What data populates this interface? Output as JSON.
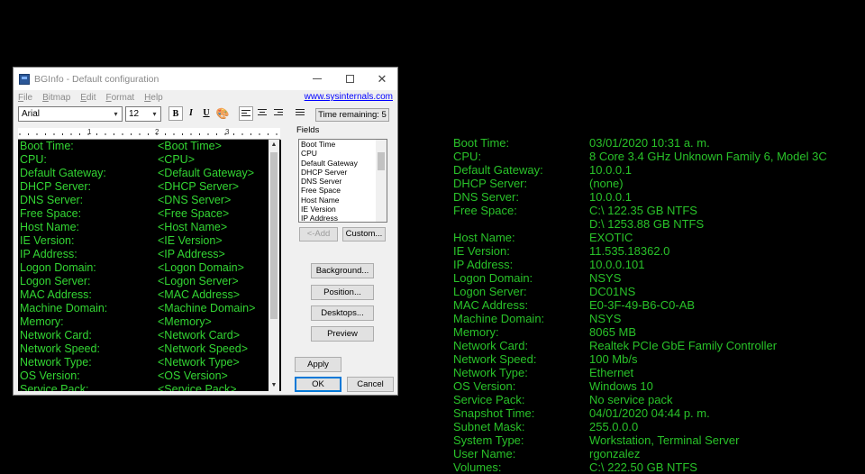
{
  "window": {
    "title": "BGInfo - Default configuration",
    "menu": [
      "File",
      "Bitmap",
      "Edit",
      "Format",
      "Help"
    ],
    "link": "www.sysinternals.com",
    "font_name": "Arial",
    "font_size": "12",
    "bold": "B",
    "italic": "I",
    "underline": "U",
    "time_remaining": "Time remaining: 5",
    "ruler_labels": [
      "1",
      "2",
      "3"
    ],
    "editor_rows": [
      {
        "label": "Boot Time:",
        "value": "<Boot Time>"
      },
      {
        "label": "CPU:",
        "value": "<CPU>"
      },
      {
        "label": "Default Gateway:",
        "value": "<Default Gateway>"
      },
      {
        "label": "DHCP Server:",
        "value": "<DHCP Server>"
      },
      {
        "label": "DNS Server:",
        "value": "<DNS Server>"
      },
      {
        "label": "Free Space:",
        "value": "<Free Space>"
      },
      {
        "label": "Host Name:",
        "value": "<Host Name>"
      },
      {
        "label": "IE Version:",
        "value": "<IE Version>"
      },
      {
        "label": "IP Address:",
        "value": "<IP Address>"
      },
      {
        "label": "Logon Domain:",
        "value": "<Logon Domain>"
      },
      {
        "label": "Logon Server:",
        "value": "<Logon Server>"
      },
      {
        "label": "MAC Address:",
        "value": "<MAC Address>"
      },
      {
        "label": "Machine Domain:",
        "value": "<Machine Domain>"
      },
      {
        "label": "Memory:",
        "value": "<Memory>"
      },
      {
        "label": "Network Card:",
        "value": "<Network Card>"
      },
      {
        "label": "Network Speed:",
        "value": "<Network Speed>"
      },
      {
        "label": "Network Type:",
        "value": "<Network Type>"
      },
      {
        "label": "OS Version:",
        "value": "<OS Version>"
      },
      {
        "label": "Service Pack:",
        "value": "<Service Pack>"
      }
    ],
    "fields_title": "Fields",
    "fields": [
      "Boot Time",
      "CPU",
      "Default Gateway",
      "DHCP Server",
      "DNS Server",
      "Free Space",
      "Host Name",
      "IE Version",
      "IP Address"
    ],
    "buttons": {
      "add": "<-Add",
      "custom": "Custom...",
      "background": "Background...",
      "position": "Position...",
      "desktops": "Desktops...",
      "preview": "Preview",
      "apply": "Apply",
      "ok": "OK",
      "cancel": "Cancel"
    }
  },
  "desktop_info": [
    {
      "label": "Boot Time:",
      "values": [
        "03/01/2020 10:31 a. m."
      ]
    },
    {
      "label": "CPU:",
      "values": [
        "8 Core 3.4 GHz Unknown Family 6, Model 3C"
      ]
    },
    {
      "label": "Default Gateway:",
      "values": [
        "10.0.0.1"
      ]
    },
    {
      "label": "DHCP Server:",
      "values": [
        "(none)"
      ]
    },
    {
      "label": "DNS Server:",
      "values": [
        "10.0.0.1"
      ]
    },
    {
      "label": "Free Space:",
      "values": [
        "C:\\ 122.35 GB NTFS",
        "D:\\ 1253.88 GB NTFS"
      ]
    },
    {
      "label": "Host Name:",
      "values": [
        "EXOTIC"
      ]
    },
    {
      "label": "IE Version:",
      "values": [
        "11.535.18362.0"
      ]
    },
    {
      "label": "IP Address:",
      "values": [
        "10.0.0.101"
      ]
    },
    {
      "label": "Logon Domain:",
      "values": [
        "NSYS"
      ]
    },
    {
      "label": "Logon Server:",
      "values": [
        "DC01NS"
      ]
    },
    {
      "label": "MAC Address:",
      "values": [
        "E0-3F-49-B6-C0-AB"
      ]
    },
    {
      "label": "Machine Domain:",
      "values": [
        "NSYS"
      ]
    },
    {
      "label": "Memory:",
      "values": [
        "8065 MB"
      ]
    },
    {
      "label": "Network Card:",
      "values": [
        "Realtek PCIe GbE Family Controller"
      ]
    },
    {
      "label": "Network Speed:",
      "values": [
        "100 Mb/s"
      ]
    },
    {
      "label": "Network Type:",
      "values": [
        "Ethernet"
      ]
    },
    {
      "label": "OS Version:",
      "values": [
        "Windows 10"
      ]
    },
    {
      "label": "Service Pack:",
      "values": [
        "No service pack"
      ]
    },
    {
      "label": "Snapshot Time:",
      "values": [
        "04/01/2020 04:44 p. m."
      ]
    },
    {
      "label": "Subnet Mask:",
      "values": [
        "255.0.0.0"
      ]
    },
    {
      "label": "System Type:",
      "values": [
        "Workstation, Terminal Server"
      ]
    },
    {
      "label": "User Name:",
      "values": [
        "rgonzalez"
      ]
    },
    {
      "label": "Volumes:",
      "values": [
        "C:\\ 222.50 GB NTFS"
      ]
    }
  ],
  "colors": {
    "desktop_text": "#29c229",
    "editor_text": "#33d633",
    "desktop_background": "#000000"
  }
}
